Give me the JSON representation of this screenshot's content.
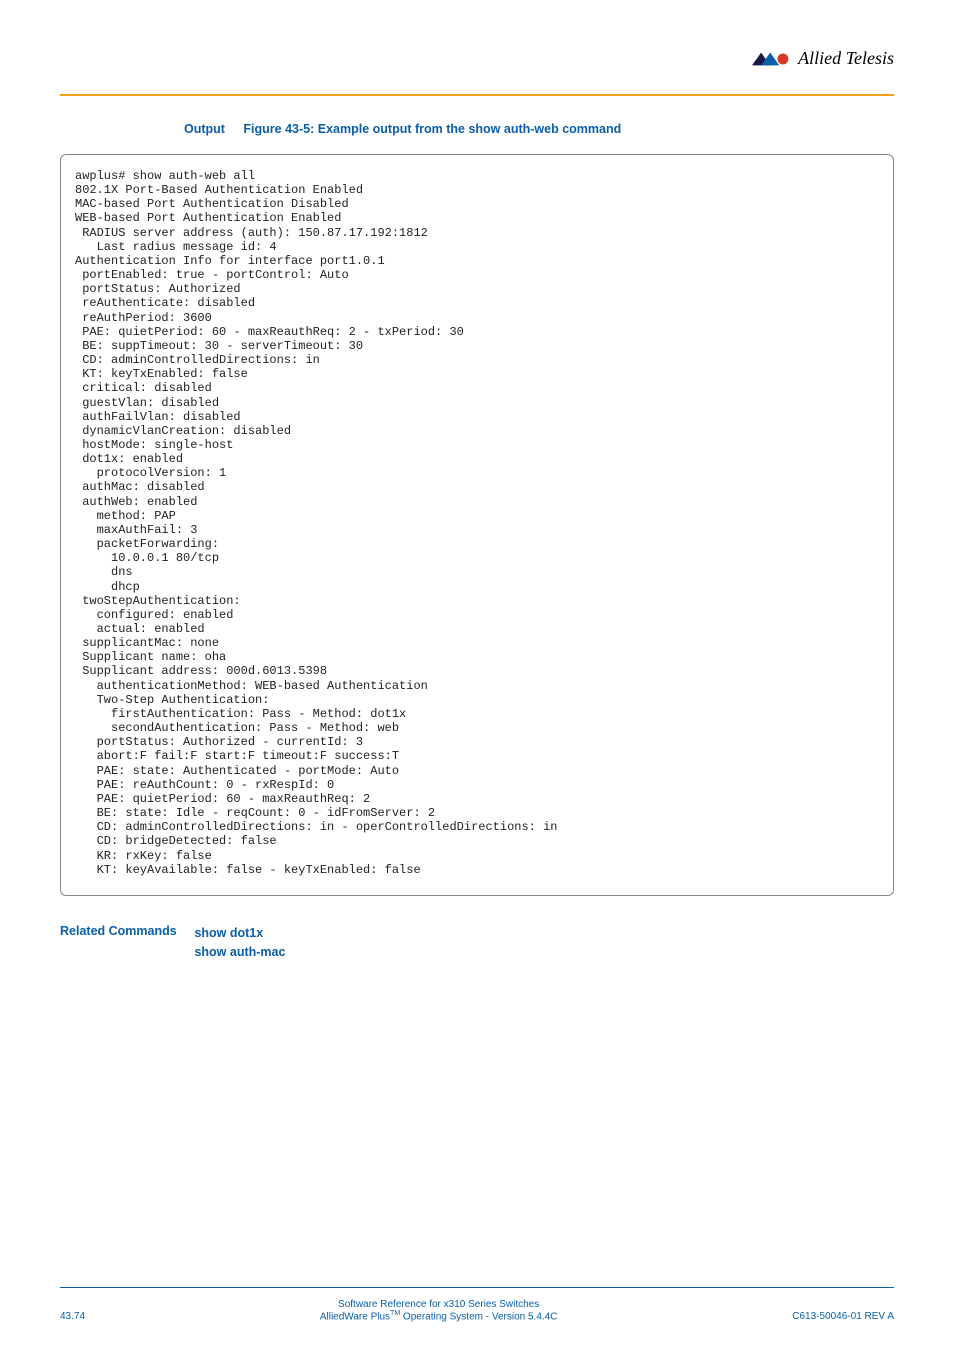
{
  "header": {
    "brand": "Allied Telesis"
  },
  "output": {
    "label": "Output",
    "figure_title": "Figure 43-5: Example output from the show auth-web command"
  },
  "code": "awplus# show auth-web all\n802.1X Port-Based Authentication Enabled\nMAC-based Port Authentication Disabled\nWEB-based Port Authentication Enabled\n RADIUS server address (auth): 150.87.17.192:1812\n   Last radius message id: 4\nAuthentication Info for interface port1.0.1\n portEnabled: true - portControl: Auto\n portStatus: Authorized\n reAuthenticate: disabled\n reAuthPeriod: 3600\n PAE: quietPeriod: 60 - maxReauthReq: 2 - txPeriod: 30\n BE: suppTimeout: 30 - serverTimeout: 30\n CD: adminControlledDirections: in\n KT: keyTxEnabled: false\n critical: disabled\n guestVlan: disabled\n authFailVlan: disabled\n dynamicVlanCreation: disabled\n hostMode: single-host\n dot1x: enabled\n   protocolVersion: 1\n authMac: disabled\n authWeb: enabled\n   method: PAP\n   maxAuthFail: 3\n   packetForwarding:\n     10.0.0.1 80/tcp\n     dns\n     dhcp\n twoStepAuthentication:\n   configured: enabled\n   actual: enabled\n supplicantMac: none\n Supplicant name: oha\n Supplicant address: 000d.6013.5398\n   authenticationMethod: WEB-based Authentication\n   Two-Step Authentication:\n     firstAuthentication: Pass - Method: dot1x\n     secondAuthentication: Pass - Method: web\n   portStatus: Authorized - currentId: 3\n   abort:F fail:F start:F timeout:F success:T\n   PAE: state: Authenticated - portMode: Auto\n   PAE: reAuthCount: 0 - rxRespId: 0\n   PAE: quietPeriod: 60 - maxReauthReq: 2\n   BE: state: Idle - reqCount: 0 - idFromServer: 2\n   CD: adminControlledDirections: in - operControlledDirections: in\n   CD: bridgeDetected: false\n   KR: rxKey: false\n   KT: keyAvailable: false - keyTxEnabled: false",
  "related": {
    "label": "Related Commands",
    "links": [
      "show dot1x",
      "show auth-mac"
    ]
  },
  "footer": {
    "page_ref": "43.74",
    "center_line1": "Software Reference for x310 Series Switches",
    "center_line2_prefix": "AlliedWare Plus",
    "center_line2_tm": "TM",
    "center_line2_suffix": " Operating System  - Version 5.4.4C",
    "doc_ref": "C613-50046-01 REV A"
  }
}
